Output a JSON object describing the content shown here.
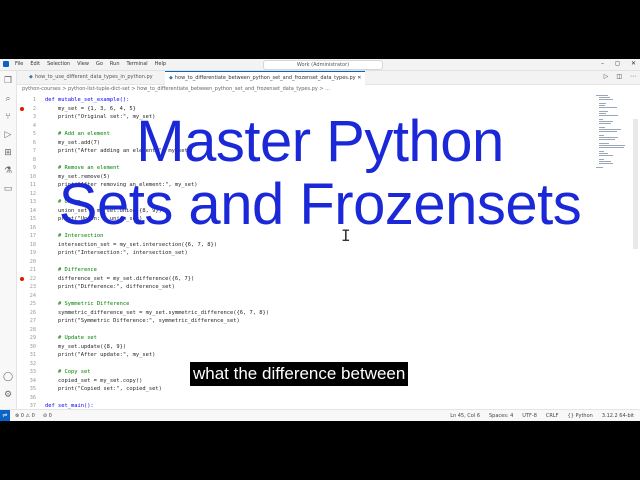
{
  "window": {
    "title": "Work (Administrator)",
    "menu": [
      "File",
      "Edit",
      "Selection",
      "View",
      "Go",
      "Run",
      "Terminal",
      "Help"
    ],
    "controls": [
      "–",
      "◻",
      "✕"
    ]
  },
  "tabs": [
    {
      "label": "how_to_use_different_data_types_in_python.py"
    },
    {
      "label": "how_to_differentiate_between_python_set_and_frozenset_data_types.py"
    }
  ],
  "breadcrumb": "python-courses > python-list-tuple-dict-set > how_to_differentiate_between_python_set_and_frozenset_data_types.py > ...",
  "code": [
    {
      "n": "1",
      "t": "def mutable_set_example():",
      "cls": "k"
    },
    {
      "n": "2",
      "t": "    my_set = {1, 3, 6, 4, 5}",
      "cls": ""
    },
    {
      "n": "3",
      "t": "    print(\"Original set:\", my_set)",
      "cls": ""
    },
    {
      "n": "4",
      "t": "",
      "cls": ""
    },
    {
      "n": "5",
      "t": "    # Add an element",
      "cls": "c"
    },
    {
      "n": "6",
      "t": "    my_set.add(7)",
      "cls": ""
    },
    {
      "n": "7",
      "t": "    print(\"After adding an element:\", my_set)",
      "cls": ""
    },
    {
      "n": "8",
      "t": "",
      "cls": ""
    },
    {
      "n": "9",
      "t": "    # Remove an element",
      "cls": "c"
    },
    {
      "n": "10",
      "t": "    my_set.remove(5)",
      "cls": ""
    },
    {
      "n": "11",
      "t": "    print(\"After removing an element:\", my_set)",
      "cls": ""
    },
    {
      "n": "12",
      "t": "",
      "cls": ""
    },
    {
      "n": "13",
      "t": "    # Union",
      "cls": "c"
    },
    {
      "n": "14",
      "t": "    union_set = my_set.union({8, 9})",
      "cls": ""
    },
    {
      "n": "15",
      "t": "    print(\"Union:\", union_set)",
      "cls": ""
    },
    {
      "n": "16",
      "t": "",
      "cls": ""
    },
    {
      "n": "17",
      "t": "    # Intersection",
      "cls": "c"
    },
    {
      "n": "18",
      "t": "    intersection_set = my_set.intersection({6, 7, 8})",
      "cls": ""
    },
    {
      "n": "19",
      "t": "    print(\"Intersection:\", intersection_set)",
      "cls": ""
    },
    {
      "n": "20",
      "t": "",
      "cls": ""
    },
    {
      "n": "21",
      "t": "    # Difference",
      "cls": "c"
    },
    {
      "n": "22",
      "t": "    difference_set = my_set.difference({6, 7})",
      "cls": ""
    },
    {
      "n": "23",
      "t": "    print(\"Difference:\", difference_set)",
      "cls": ""
    },
    {
      "n": "24",
      "t": "",
      "cls": ""
    },
    {
      "n": "25",
      "t": "    # Symmetric Difference",
      "cls": "c"
    },
    {
      "n": "26",
      "t": "    symmetric_difference_set = my_set.symmetric_difference({6, 7, 8})",
      "cls": ""
    },
    {
      "n": "27",
      "t": "    print(\"Symmetric Difference:\", symmetric_difference_set)",
      "cls": ""
    },
    {
      "n": "28",
      "t": "",
      "cls": ""
    },
    {
      "n": "29",
      "t": "    # Update set",
      "cls": "c"
    },
    {
      "n": "30",
      "t": "    my_set.update({8, 9})",
      "cls": ""
    },
    {
      "n": "31",
      "t": "    print(\"After update:\", my_set)",
      "cls": ""
    },
    {
      "n": "32",
      "t": "",
      "cls": ""
    },
    {
      "n": "33",
      "t": "    # Copy set",
      "cls": "c"
    },
    {
      "n": "34",
      "t": "    copied_set = my_set.copy()",
      "cls": ""
    },
    {
      "n": "35",
      "t": "    print(\"Copied set:\", copied_set)",
      "cls": ""
    },
    {
      "n": "36",
      "t": "",
      "cls": ""
    },
    {
      "n": "37",
      "t": "def set_main():",
      "cls": "k"
    }
  ],
  "breakpoint_lines": [
    "2",
    "22"
  ],
  "overlay": {
    "line1": "Master Python",
    "line2": "Sets and Frozensets"
  },
  "caption": "what the difference between",
  "status": {
    "left": [
      "⊗ 0 ⚠ 0",
      "⊘ 0"
    ],
    "right": [
      "Ln 45, Col 6",
      "Spaces: 4",
      "UTF-8",
      "CRLF",
      "{} Python",
      "3.12.2 64-bit"
    ]
  }
}
